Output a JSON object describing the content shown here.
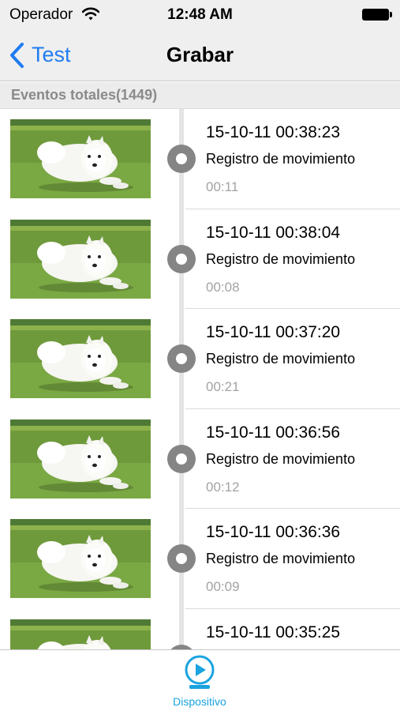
{
  "status_bar": {
    "carrier": "Operador",
    "time": "12:48 AM"
  },
  "nav": {
    "back_label": "Test",
    "title": "Grabar"
  },
  "section": {
    "header": "Eventos totales(1449)"
  },
  "events": [
    {
      "datetime": "15-10-11 00:38:23",
      "type": "Registro de movimiento",
      "duration": "00:11"
    },
    {
      "datetime": "15-10-11 00:38:04",
      "type": "Registro de movimiento",
      "duration": "00:08"
    },
    {
      "datetime": "15-10-11 00:37:20",
      "type": "Registro de movimiento",
      "duration": "00:21"
    },
    {
      "datetime": "15-10-11 00:36:56",
      "type": "Registro de movimiento",
      "duration": "00:12"
    },
    {
      "datetime": "15-10-11 00:36:36",
      "type": "Registro de movimiento",
      "duration": "00:09"
    },
    {
      "datetime": "15-10-11 00:35:25",
      "type": "",
      "duration": ""
    }
  ],
  "tab_bar": {
    "device_label": "Dispositivo"
  },
  "colors": {
    "accent": "#1f7cf2",
    "tab_accent": "#1aa3df",
    "node": "#858585",
    "duration_text": "#a3a3a3"
  },
  "icons": {
    "back": "chevron-left-icon",
    "wifi": "wifi-icon",
    "battery": "battery-icon",
    "device_tab": "camera-play-icon"
  }
}
